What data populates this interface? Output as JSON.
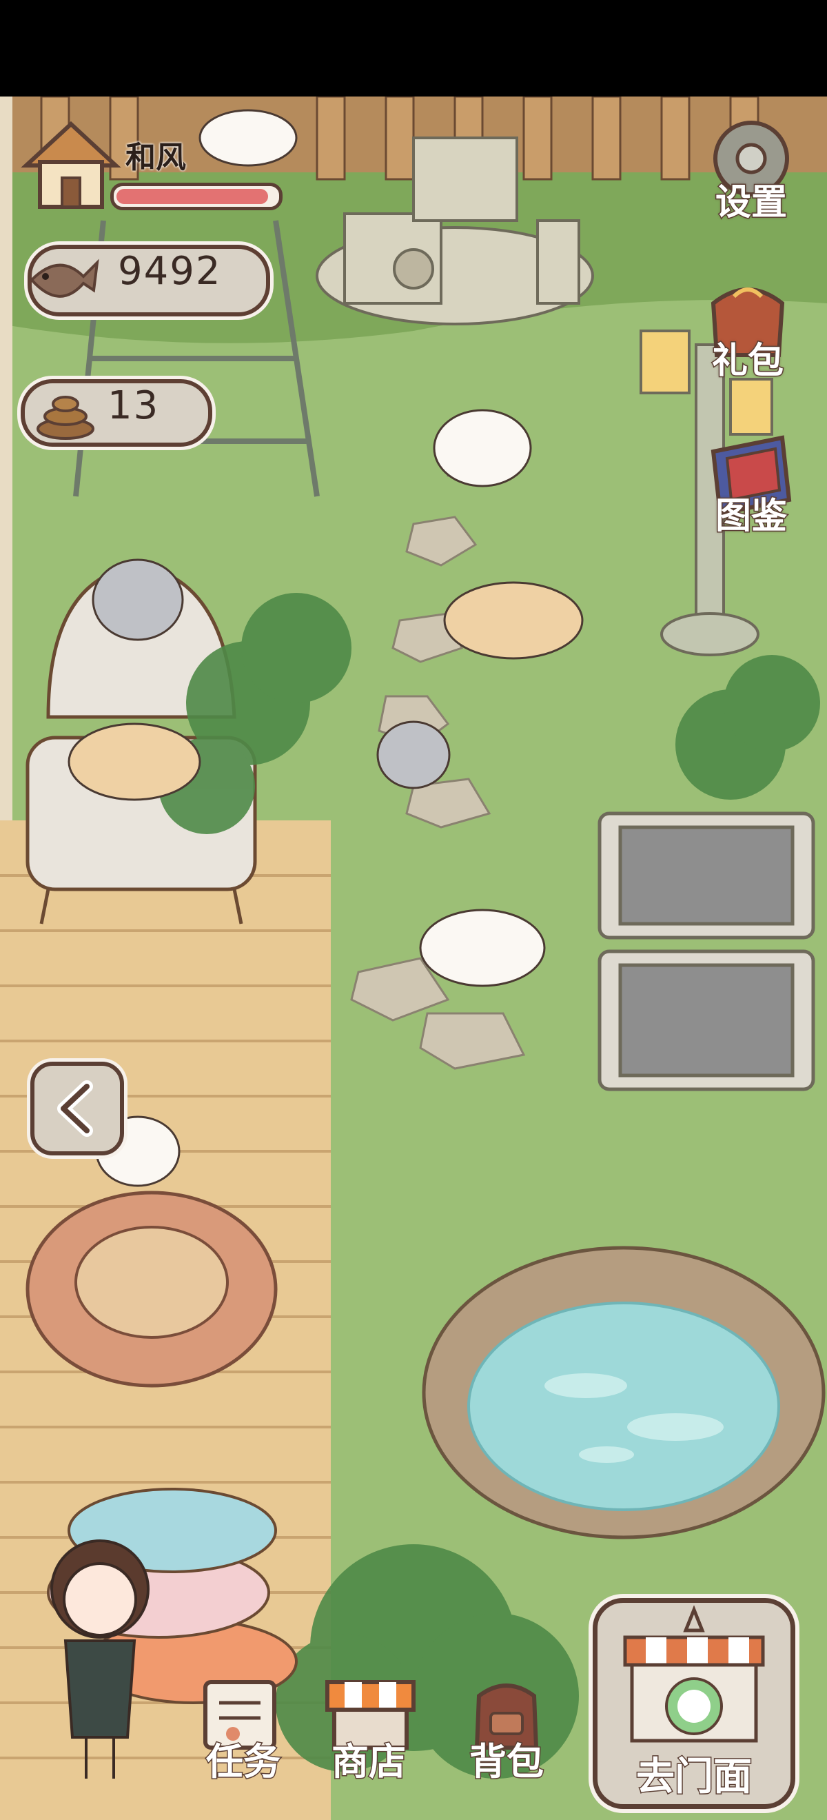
{
  "player": {
    "name": "和风",
    "exp_progress": 0.95
  },
  "currency": {
    "fish": "9492",
    "poop": "13"
  },
  "side_buttons": {
    "settings": "设置",
    "gift": "礼包",
    "collection": "图鉴"
  },
  "bottom_nav": {
    "tasks": "任务",
    "shop": "商店",
    "backpack": "背包",
    "store": "去门面"
  },
  "icons": {
    "house": "house-icon",
    "fish": "fish-icon",
    "poop": "poop-icon",
    "gear": "gear-icon",
    "gift": "gift-bag-icon",
    "book": "book-icon",
    "back": "chevron-left-icon",
    "tasks": "task-scroll-icon",
    "shop": "shop-awning-icon",
    "backpack": "backpack-icon",
    "store": "storefront-icon"
  },
  "colors": {
    "outline": "#5b3f34",
    "health": "#e37272",
    "grass": "#8fb56a",
    "deck": "#e6c89a",
    "pond": "#9ed9d9"
  }
}
